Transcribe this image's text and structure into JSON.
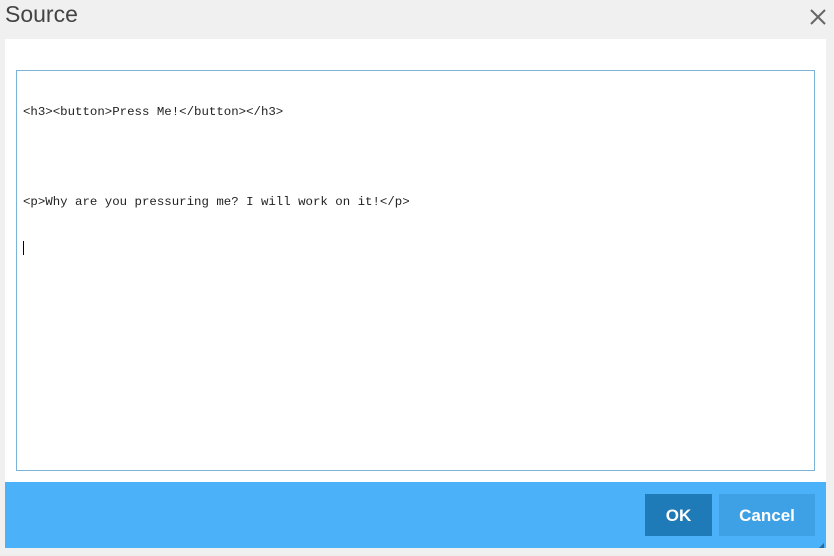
{
  "dialog": {
    "title": "Source",
    "close_icon": "close-x-icon"
  },
  "editor": {
    "lines": [
      "<h3><button>Press Me!</button></h3>",
      "",
      "<p>Why are you pressuring me? I will work on it!</p>",
      ""
    ]
  },
  "footer": {
    "ok_label": "OK",
    "cancel_label": "Cancel",
    "resize_icon": "resize-handle-icon"
  },
  "colors": {
    "footer_bg": "#4bb1f9",
    "ok_bg": "#1f7ab8",
    "cancel_bg": "#3ea1e6",
    "editor_border": "#7cb4d8"
  }
}
